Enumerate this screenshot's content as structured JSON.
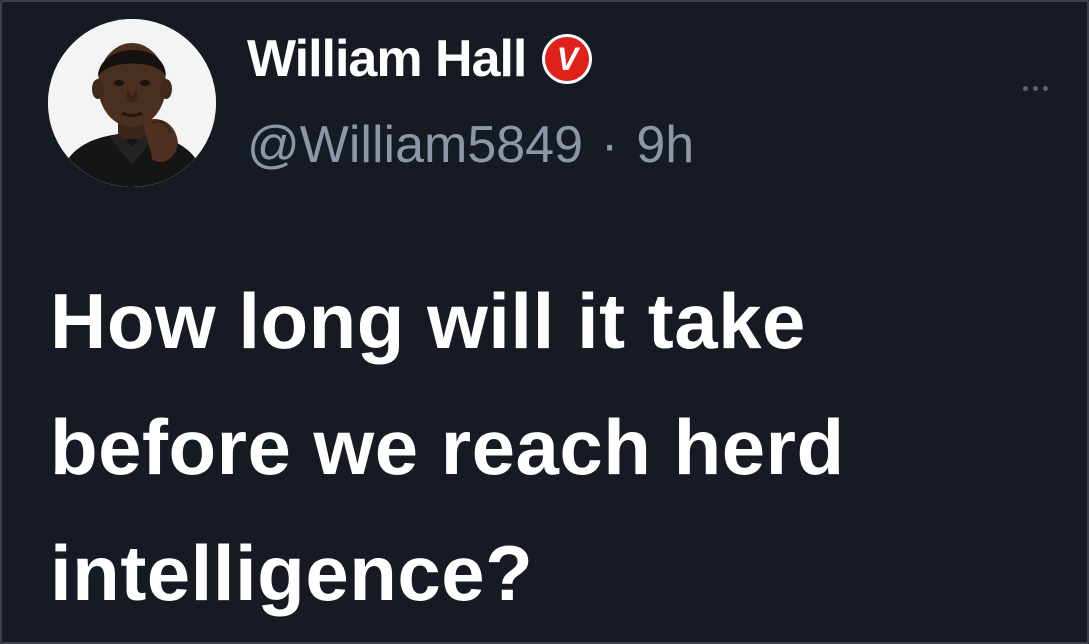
{
  "author": {
    "display_name": "William Hall",
    "verified_badge": "V",
    "handle": "@William5849",
    "separator": "·",
    "timestamp": "9h"
  },
  "tweet": {
    "lines": [
      "How long will it take",
      "before we reach herd",
      "intelligence?"
    ]
  },
  "icons": {
    "avatar": "avatar-photo",
    "verified": "verified-badge-icon",
    "more": "more-options-icon"
  },
  "colors": {
    "background": "#151a23",
    "text_primary": "#ffffff",
    "text_secondary": "#8c96a5",
    "badge": "#e0201b"
  }
}
